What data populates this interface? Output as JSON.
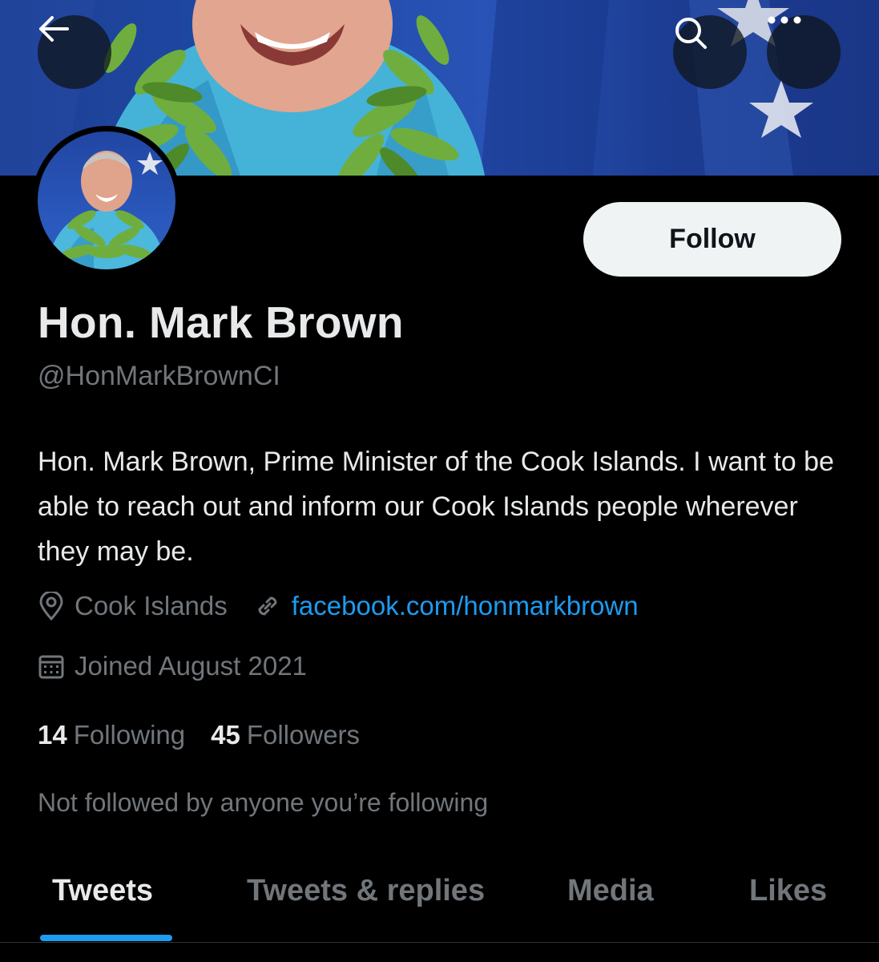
{
  "header": {
    "back_icon": "arrow-left-icon",
    "search_icon": "search-icon",
    "more_icon": "more-horizontal-icon"
  },
  "profile": {
    "name": "Hon. Mark Brown",
    "handle": "@HonMarkBrownCI",
    "follow_label": "Follow",
    "bio": "Hon. Mark Brown, Prime Minister of the Cook Islands. I want to be able to reach out and inform our Cook Islands people wherever they may be.",
    "location": "Cook Islands",
    "website": "facebook.com/honmarkbrown",
    "joined": "Joined August 2021",
    "following_count": "14",
    "following_label": "Following",
    "followers_count": "45",
    "followers_label": "Followers",
    "not_followed_text": "Not followed by anyone you’re following"
  },
  "tabs": [
    {
      "label": "Tweets",
      "active": true
    },
    {
      "label": "Tweets & replies",
      "active": false
    },
    {
      "label": "Media",
      "active": false
    },
    {
      "label": "Likes",
      "active": false
    }
  ],
  "colors": {
    "background": "#000000",
    "accent": "#1d9bf0",
    "text_primary": "#e7e9ea",
    "text_secondary": "#71767b",
    "follow_button_bg": "#eff3f4"
  }
}
